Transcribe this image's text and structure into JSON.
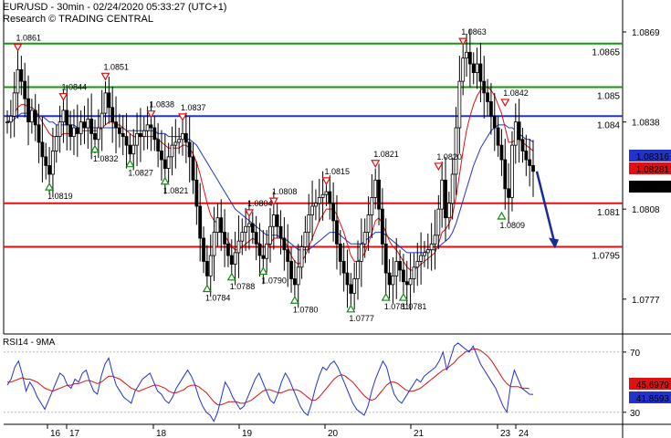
{
  "header": {
    "line1": "EUR/USD - 30min - 02/24/2020 05:33:27 (UTC+1)",
    "line2": "Research © TRADING CENTRAL"
  },
  "chart_data": [
    {
      "type": "candlestick",
      "title": "EUR/USD - 30min - 02/24/2020 05:33:27 (UTC+1)",
      "ylim": [
        1.0765,
        1.088
      ],
      "y_ticks": [
        "1.0869",
        "1.0838",
        "1.0808",
        "1.0777"
      ],
      "x_ticks": [
        "16",
        "17",
        "18",
        "19",
        "20",
        "21",
        "23",
        "24"
      ],
      "grid": false,
      "levels": [
        {
          "value": 1.0865,
          "label": "1.0865",
          "color": "#119911"
        },
        {
          "value": 1.085,
          "label": "1.085",
          "color": "#119911"
        },
        {
          "value": 1.084,
          "label": "1.084",
          "color": "#2233cc"
        },
        {
          "value": 1.081,
          "label": "1.081",
          "color": "#dd1111"
        },
        {
          "value": 1.0795,
          "label": "1.0795",
          "color": "#dd1111"
        }
      ],
      "price_tags": [
        {
          "value": 1.08316,
          "label": "1.08316",
          "bg": "#2233cc",
          "fg": "#ffffff"
        },
        {
          "value": 1.08281,
          "label": "1.08281",
          "bg": "#dd1111",
          "fg": "#ffffff"
        },
        {
          "value": 1.08211,
          "label": "1.08211",
          "bg": "#000000",
          "fg": "#ffffff"
        }
      ],
      "pivots": [
        {
          "i": 3,
          "value": 1.0861,
          "kind": "high",
          "label": "1.0861"
        },
        {
          "i": 12,
          "value": 1.0819,
          "kind": "low",
          "label": "1.0819"
        },
        {
          "i": 16,
          "value": 1.0844,
          "kind": "high",
          "label": "1.0844"
        },
        {
          "i": 25,
          "value": 1.0832,
          "kind": "low",
          "label": "1.0832"
        },
        {
          "i": 28,
          "value": 1.0851,
          "kind": "high",
          "label": "1.0851"
        },
        {
          "i": 35,
          "value": 1.0827,
          "kind": "low",
          "label": "1.0827"
        },
        {
          "i": 41,
          "value": 1.0838,
          "kind": "high",
          "label": "1.0838"
        },
        {
          "i": 45,
          "value": 1.0821,
          "kind": "low",
          "label": "1.0821"
        },
        {
          "i": 50,
          "value": 1.0837,
          "kind": "high",
          "label": "1.0837"
        },
        {
          "i": 57,
          "value": 1.0784,
          "kind": "low",
          "label": "1.0784"
        },
        {
          "i": 64,
          "value": 1.0788,
          "kind": "low",
          "label": "1.0788"
        },
        {
          "i": 69,
          "value": 1.0804,
          "kind": "high",
          "label": "1.0804"
        },
        {
          "i": 73,
          "value": 1.079,
          "kind": "low",
          "label": "1.0790"
        },
        {
          "i": 76,
          "value": 1.0808,
          "kind": "high",
          "label": "1.0808"
        },
        {
          "i": 82,
          "value": 1.078,
          "kind": "low",
          "label": "1.0780"
        },
        {
          "i": 91,
          "value": 1.0815,
          "kind": "high",
          "label": "1.0815"
        },
        {
          "i": 98,
          "value": 1.0777,
          "kind": "low",
          "label": "1.0777"
        },
        {
          "i": 105,
          "value": 1.0821,
          "kind": "high",
          "label": "1.0821"
        },
        {
          "i": 108,
          "value": 1.0781,
          "kind": "low",
          "label": "1.0781"
        },
        {
          "i": 113,
          "value": 1.0781,
          "kind": "low",
          "label": "1.0781"
        },
        {
          "i": 123,
          "value": 1.082,
          "kind": "high",
          "label": "1.0820"
        },
        {
          "i": 130,
          "value": 1.0863,
          "kind": "high",
          "label": "1.0863"
        },
        {
          "i": 142,
          "value": 1.0842,
          "kind": "high",
          "label": "1.0842"
        },
        {
          "i": 141,
          "value": 1.0809,
          "kind": "low",
          "label": "1.0809"
        }
      ],
      "close_series": [
        1.0838,
        1.084,
        1.0848,
        1.0856,
        1.0852,
        1.0846,
        1.0838,
        1.0842,
        1.0837,
        1.0831,
        1.0826,
        1.0823,
        1.082,
        1.0828,
        1.0833,
        1.0838,
        1.0842,
        1.0837,
        1.0833,
        1.0836,
        1.0834,
        1.0838,
        1.0836,
        1.0839,
        1.0834,
        1.0832,
        1.0836,
        1.0841,
        1.0848,
        1.0843,
        1.0838,
        1.0836,
        1.0834,
        1.0833,
        1.083,
        1.0827,
        1.083,
        1.0834,
        1.0833,
        1.0835,
        1.0837,
        1.0836,
        1.0832,
        1.0828,
        1.0825,
        1.0822,
        1.0826,
        1.083,
        1.0831,
        1.0832,
        1.0834,
        1.0831,
        1.0826,
        1.0818,
        1.0809,
        1.0798,
        1.079,
        1.0785,
        1.0792,
        1.08,
        1.0805,
        1.08,
        1.0796,
        1.0792,
        1.0789,
        1.0793,
        1.0797,
        1.08,
        1.0802,
        1.0803,
        1.08,
        1.0796,
        1.0792,
        1.0791,
        1.0796,
        1.0802,
        1.0806,
        1.0802,
        1.0798,
        1.0794,
        1.079,
        1.0784,
        1.0782,
        1.0788,
        1.0795,
        1.08,
        1.0806,
        1.0809,
        1.081,
        1.0812,
        1.0813,
        1.0814,
        1.081,
        1.0804,
        1.0796,
        1.079,
        1.0786,
        1.0782,
        1.0779,
        1.0784,
        1.079,
        1.0796,
        1.08,
        1.0806,
        1.0812,
        1.0818,
        1.0808,
        1.0796,
        1.0786,
        1.0782,
        1.0785,
        1.079,
        1.0787,
        1.0783,
        1.0782,
        1.0784,
        1.0788,
        1.079,
        1.0792,
        1.0793,
        1.0794,
        1.0796,
        1.0799,
        1.0808,
        1.0818,
        1.0805,
        1.081,
        1.082,
        1.0836,
        1.0852,
        1.086,
        1.0862,
        1.0858,
        1.0855,
        1.0858,
        1.0852,
        1.0848,
        1.0845,
        1.084,
        1.0836,
        1.083,
        1.0825,
        1.0815,
        1.0812,
        1.083,
        1.0838,
        1.0832,
        1.0828,
        1.0825,
        1.0823,
        1.0821
      ],
      "forecast_to": 1.0795,
      "ma_fast": [
        1.0838,
        1.0839,
        1.0841,
        1.0843,
        1.0844,
        1.0844,
        1.0843,
        1.0843,
        1.0842,
        1.084,
        1.0838,
        1.0836,
        1.0834,
        1.0833,
        1.0833,
        1.0833,
        1.0834,
        1.0834,
        1.0834,
        1.0834,
        1.0834,
        1.0835,
        1.0835,
        1.0835,
        1.0835,
        1.0835,
        1.0835,
        1.0836,
        1.0837,
        1.0838,
        1.0838,
        1.0837,
        1.0837,
        1.0836,
        1.0835,
        1.0834,
        1.0833,
        1.0833,
        1.0833,
        1.0833,
        1.0833,
        1.0833,
        1.0833,
        1.0832,
        1.0831,
        1.083,
        1.0829,
        1.0829,
        1.0829,
        1.0829,
        1.083,
        1.083,
        1.0829,
        1.0827,
        1.0824,
        1.082,
        1.0815,
        1.081,
        1.0806,
        1.0804,
        1.0803,
        1.0801,
        1.0799,
        1.0797,
        1.0795,
        1.0794,
        1.0794,
        1.0795,
        1.0796,
        1.0797,
        1.0798,
        1.0797,
        1.0796,
        1.0795,
        1.0795,
        1.0796,
        1.0798,
        1.0798,
        1.0798,
        1.0797,
        1.0795,
        1.0792,
        1.079,
        1.0789,
        1.079,
        1.0792,
        1.0795,
        1.0798,
        1.0801,
        1.0804,
        1.0806,
        1.0808,
        1.0808,
        1.0808,
        1.0806,
        1.0803,
        1.08,
        1.0796,
        1.0792,
        1.079,
        1.079,
        1.0791,
        1.0793,
        1.0796,
        1.08,
        1.0804,
        1.0805,
        1.0803,
        1.08,
        1.0797,
        1.0795,
        1.0794,
        1.0792,
        1.079,
        1.0788,
        1.0787,
        1.0787,
        1.0788,
        1.0789,
        1.079,
        1.0791,
        1.0792,
        1.0793,
        1.0796,
        1.08,
        1.0801,
        1.0803,
        1.0806,
        1.0812,
        1.082,
        1.0828,
        1.0835,
        1.084,
        1.0844,
        1.0847,
        1.0849,
        1.085,
        1.085,
        1.0849,
        1.0847,
        1.0844,
        1.0841,
        1.0836,
        1.0831,
        1.0831,
        1.0832,
        1.0832,
        1.0831,
        1.083,
        1.0829,
        1.0828
      ],
      "ma_slow": [
        1.0838,
        1.0838,
        1.0839,
        1.084,
        1.0841,
        1.0841,
        1.0841,
        1.0841,
        1.0841,
        1.084,
        1.084,
        1.0839,
        1.0838,
        1.0838,
        1.0837,
        1.0837,
        1.0837,
        1.0837,
        1.0837,
        1.0837,
        1.0836,
        1.0836,
        1.0836,
        1.0836,
        1.0836,
        1.0836,
        1.0836,
        1.0836,
        1.0836,
        1.0836,
        1.0836,
        1.0836,
        1.0836,
        1.0836,
        1.0835,
        1.0835,
        1.0835,
        1.0835,
        1.0835,
        1.0835,
        1.0835,
        1.0835,
        1.0835,
        1.0834,
        1.0834,
        1.0834,
        1.0833,
        1.0833,
        1.0833,
        1.0833,
        1.0833,
        1.0832,
        1.0832,
        1.0831,
        1.083,
        1.0828,
        1.0826,
        1.0824,
        1.0822,
        1.082,
        1.0818,
        1.0816,
        1.0814,
        1.0812,
        1.081,
        1.0808,
        1.0807,
        1.0806,
        1.0805,
        1.0804,
        1.0803,
        1.0802,
        1.0801,
        1.08,
        1.0799,
        1.0799,
        1.0799,
        1.0799,
        1.0798,
        1.0798,
        1.0797,
        1.0796,
        1.0795,
        1.0794,
        1.0794,
        1.0794,
        1.0794,
        1.0795,
        1.0796,
        1.0797,
        1.0798,
        1.0799,
        1.08,
        1.08,
        1.08,
        1.0799,
        1.0798,
        1.0797,
        1.0796,
        1.0796,
        1.0796,
        1.0796,
        1.0797,
        1.0798,
        1.0799,
        1.08,
        1.08,
        1.08,
        1.0799,
        1.0798,
        1.0797,
        1.0796,
        1.0795,
        1.0794,
        1.0793,
        1.0793,
        1.0793,
        1.0793,
        1.0793,
        1.0793,
        1.0794,
        1.0794,
        1.0794,
        1.0795,
        1.0796,
        1.0797,
        1.0798,
        1.08,
        1.0803,
        1.0807,
        1.0811,
        1.0815,
        1.0819,
        1.0823,
        1.0826,
        1.0829,
        1.0831,
        1.0833,
        1.0835,
        1.0836,
        1.0837,
        1.0837,
        1.0837,
        1.0836,
        1.0836,
        1.0835,
        1.0834,
        1.0833,
        1.0832,
        1.0832,
        1.0831
      ]
    },
    {
      "type": "line",
      "title": "RSI14 - 9MA",
      "ylim": [
        22,
        82
      ],
      "y_ticks": [
        "70",
        "30"
      ],
      "levels": [
        70,
        30
      ],
      "price_tags": [
        {
          "value": 45.6979,
          "label": "45.6979",
          "bg": "#dd1111",
          "fg": "#ffffff"
        },
        {
          "value": 41.8593,
          "label": "41.8593",
          "bg": "#2233cc",
          "fg": "#ffffff"
        }
      ],
      "series": [
        {
          "name": "RSI14",
          "color": "#2233cc",
          "values": [
            48,
            52,
            60,
            64,
            55,
            44,
            50,
            46,
            40,
            36,
            32,
            38,
            44,
            50,
            56,
            54,
            48,
            46,
            52,
            50,
            56,
            58,
            50,
            44,
            42,
            54,
            62,
            66,
            56,
            48,
            44,
            40,
            38,
            36,
            44,
            48,
            52,
            54,
            56,
            50,
            44,
            42,
            38,
            36,
            40,
            46,
            50,
            54,
            58,
            54,
            48,
            40,
            34,
            30,
            28,
            24,
            30,
            40,
            50,
            46,
            40,
            36,
            32,
            34,
            40,
            46,
            52,
            56,
            50,
            44,
            38,
            36,
            42,
            50,
            56,
            52,
            46,
            40,
            34,
            30,
            28,
            36,
            46,
            54,
            60,
            58,
            62,
            64,
            60,
            54,
            48,
            42,
            36,
            32,
            30,
            28,
            34,
            44,
            52,
            58,
            64,
            60,
            50,
            42,
            38,
            36,
            40,
            44,
            48,
            52,
            50,
            54,
            56,
            58,
            60,
            64,
            70,
            58,
            66,
            74,
            76,
            74,
            72,
            70,
            74,
            68,
            62,
            58,
            54,
            50,
            46,
            40,
            34,
            30,
            48,
            58,
            52,
            46,
            44,
            42,
            41.9
          ]
        },
        {
          "name": "9MA",
          "color": "#dd1111",
          "values": [
            50,
            50,
            51,
            52,
            53,
            52,
            52,
            51,
            50,
            48,
            46,
            45,
            44,
            45,
            46,
            47,
            48,
            48,
            49,
            49,
            50,
            51,
            51,
            50,
            49,
            50,
            52,
            54,
            54,
            53,
            52,
            50,
            48,
            46,
            45,
            44,
            45,
            46,
            47,
            48,
            48,
            47,
            46,
            44,
            43,
            43,
            44,
            45,
            47,
            48,
            48,
            47,
            45,
            43,
            40,
            37,
            35,
            35,
            36,
            37,
            37,
            37,
            36,
            36,
            37,
            38,
            40,
            42,
            44,
            45,
            45,
            44,
            43,
            43,
            44,
            45,
            45,
            45,
            44,
            42,
            40,
            38,
            38,
            40,
            43,
            46,
            49,
            52,
            54,
            55,
            54,
            52,
            50,
            47,
            44,
            41,
            39,
            38,
            39,
            42,
            45,
            48,
            50,
            50,
            49,
            47,
            45,
            44,
            44,
            45,
            46,
            48,
            50,
            52,
            54,
            56,
            58,
            59,
            61,
            63,
            66,
            68,
            70,
            71,
            72,
            72,
            71,
            69,
            67,
            64,
            60,
            56,
            52,
            49,
            47,
            47,
            47,
            46,
            46,
            45.7
          ]
        }
      ]
    }
  ]
}
